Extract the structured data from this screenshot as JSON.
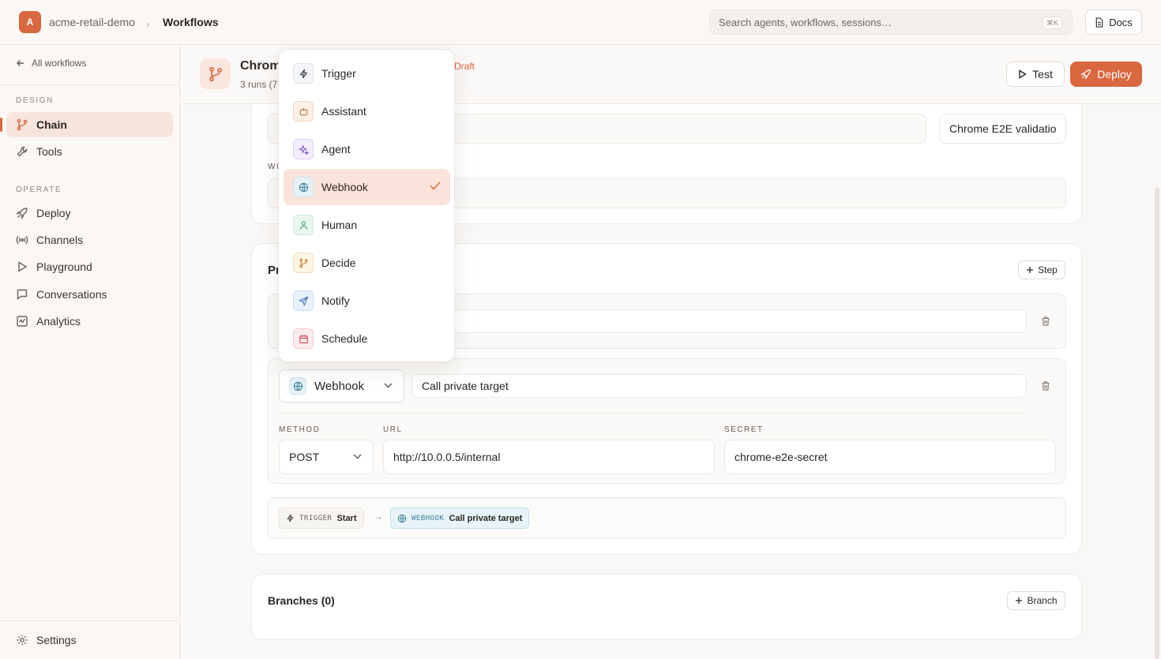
{
  "colors": {
    "accent": "#d9673f",
    "accent_soft": "#f9e3da",
    "border": "#ece6e0"
  },
  "topbar": {
    "org_initial": "A",
    "org_name": "acme-retail-demo",
    "breadcrumb_sep": "›",
    "breadcrumb_current": "Workflows",
    "search_placeholder": "Search agents, workflows, sessions…",
    "search_shortcut": "⌘K",
    "docs_label": "Docs"
  },
  "sidebar": {
    "back_label": "All workflows",
    "design_section": "DESIGN",
    "design_items": [
      {
        "label": "Chain",
        "icon": "branch-icon"
      },
      {
        "label": "Tools",
        "icon": "wrench-icon"
      }
    ],
    "operate_section": "OPERATE",
    "operate_items": [
      {
        "label": "Deploy",
        "icon": "rocket-icon"
      },
      {
        "label": "Channels",
        "icon": "broadcast-icon"
      },
      {
        "label": "Playground",
        "icon": "play-icon"
      },
      {
        "label": "Conversations",
        "icon": "message-icon"
      },
      {
        "label": "Analytics",
        "icon": "chart-icon"
      }
    ],
    "settings_label": "Settings"
  },
  "workflow": {
    "title": "Chrom",
    "meta": "3 runs (7",
    "status": "Draft",
    "test_label": "Test",
    "deploy_label": "Deploy"
  },
  "details": {
    "name_value": "Chrome E2E validatio",
    "label_fragment": "WI"
  },
  "pipeline": {
    "title_fragment": "Pr",
    "add_step_label": "Step",
    "step2": {
      "type_label": "Webhook",
      "name_value": "Call private target",
      "method_label": "METHOD",
      "method_value": "POST",
      "url_label": "URL",
      "url_value": "http://10.0.0.5/internal",
      "secret_label": "SECRET",
      "secret_value": "chrome-e2e-secret"
    },
    "flow": {
      "chip1_kind": "TRIGGER",
      "chip1_name": "Start",
      "arrow": "→",
      "chip2_kind": "WEBHOOK",
      "chip2_name": "Call private target"
    }
  },
  "branches": {
    "title": "Branches (0)",
    "add_label": "Branch"
  },
  "menu": {
    "items": [
      {
        "label": "Trigger",
        "icon": "bolt-icon"
      },
      {
        "label": "Assistant",
        "icon": "robot-icon"
      },
      {
        "label": "Agent",
        "icon": "sparkle-icon"
      },
      {
        "label": "Webhook",
        "icon": "globe-icon",
        "selected": true
      },
      {
        "label": "Human",
        "icon": "person-icon"
      },
      {
        "label": "Decide",
        "icon": "branch-icon"
      },
      {
        "label": "Notify",
        "icon": "send-icon"
      },
      {
        "label": "Schedule",
        "icon": "calendar-icon"
      }
    ]
  }
}
